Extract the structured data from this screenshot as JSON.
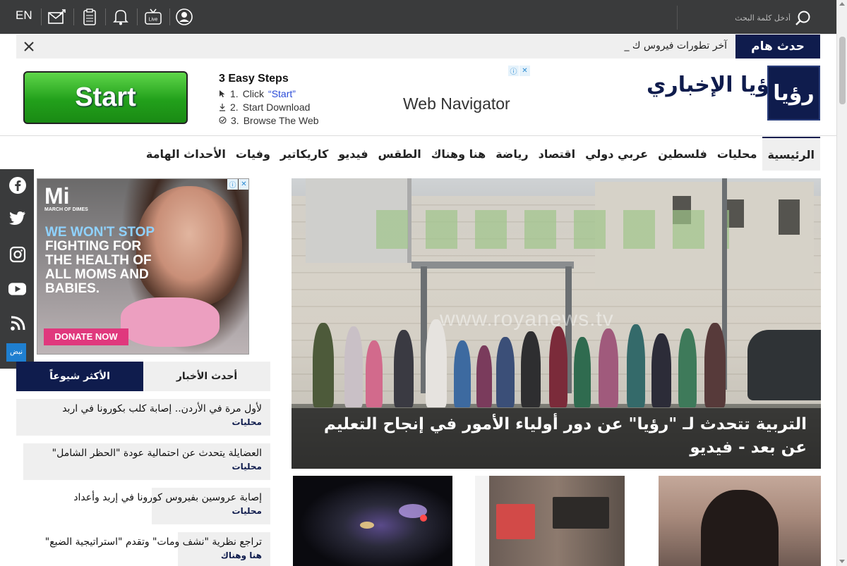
{
  "header": {
    "lang_label": "EN",
    "search_placeholder": "أدخل كلمة البحث",
    "icons": [
      "user-icon",
      "live-tv-icon",
      "bell-icon",
      "clipboard-icon",
      "mail-icon"
    ],
    "live_badge": "Live"
  },
  "breaking": {
    "label": "حدث هام",
    "text": "آخر تطورات فيروس ك _"
  },
  "ad_banner": {
    "button_label": "Start",
    "steps_title": "3 Easy Steps",
    "step1_num": "1.",
    "step1_text": "Click",
    "step1_link": "“Start”",
    "step2_num": "2.",
    "step2_text": "Start Download",
    "step3_num": "3.",
    "step3_text": "Browse The Web",
    "product": "Web Navigator",
    "adchoice_i": "ⓘ",
    "adchoice_x": "✕"
  },
  "logo": {
    "text": "رؤيا الإخباري",
    "mark": "رؤيا"
  },
  "nav": {
    "items": [
      "الرئيسية",
      "محليات",
      "فلسطين",
      "عربي دولي",
      "اقتصاد",
      "رياضة",
      "هنا وهناك",
      "الطقس",
      "فيديو",
      "كاريكاتير",
      "وفيات",
      "الأحداث الهامة"
    ]
  },
  "social": {
    "icons": [
      "facebook-icon",
      "twitter-icon",
      "instagram-icon",
      "youtube-icon",
      "rss-icon"
    ],
    "nabd_label": "نبض"
  },
  "side_ad": {
    "logo_mark": "Mi",
    "logo_text": "MARCH OF DIMES",
    "line1": "WE WON'T STOP",
    "line2": "FIGHTING FOR",
    "line3": "THE HEALTH OF",
    "line4": "ALL MOMS AND",
    "line5": "BABIES.",
    "cta": "DONATE NOW"
  },
  "tabs": {
    "latest": "أحدث الأخبار",
    "popular": "الأكثر شيوعاً"
  },
  "news": [
    {
      "title": "لأول مرة في الأردن.. إصابة كلب بكورونا في اربد",
      "category": "محليات"
    },
    {
      "title": "العضايلة يتحدث عن احتمالية عودة \"الحظر الشامل\"",
      "category": "محليات"
    },
    {
      "title": "إصابة عروسين بفيروس كورونا في إربد وأعداد",
      "category": "محليات"
    },
    {
      "title": "تراجع نظرية \"نشف ومات\" وتقدم \"استراتيجية الضبع\"",
      "category": "هنا وهناك"
    }
  ],
  "hero": {
    "watermark": "www.royanews.tv",
    "caption": "التربية تتحدث لـ \"رؤيا\" عن دور أولياء الأمور في إنجاح التعليم عن بعد - فيديو"
  }
}
